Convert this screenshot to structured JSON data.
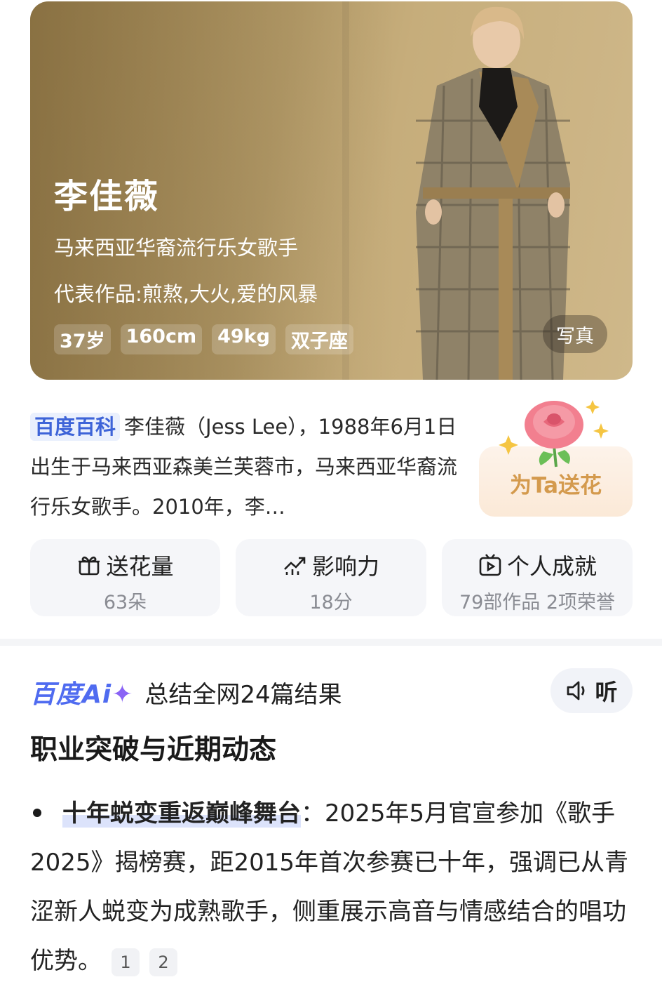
{
  "hero": {
    "name": "李佳薇",
    "subtitle": "马来西亚华裔流行乐女歌手",
    "works": "代表作品:煎熬,大火,爱的风暴",
    "tags": [
      "37岁",
      "160cm",
      "49kg",
      "双子座"
    ],
    "photo_button": "写真"
  },
  "intro": {
    "badge": "百度百科",
    "text": "李佳薇（Jess Lee），1988年6月1日出生于马来西亚森美兰芙蓉市，马来西亚华裔流行乐女歌手。2010年，李…"
  },
  "flower": {
    "label": "为Ta送花"
  },
  "stats": [
    {
      "title": "送花量",
      "value": "63朵",
      "icon": "gift-icon"
    },
    {
      "title": "影响力",
      "value": "18分",
      "icon": "trend-up-icon"
    },
    {
      "title": "个人成就",
      "value": "79部作品 2项荣誉",
      "icon": "play-tv-icon"
    }
  ],
  "ai": {
    "logo": "百度Ai",
    "summary": "总结全网24篇结果",
    "listen_label": "听"
  },
  "section": {
    "title": "职业突破与近期动态",
    "bullet_highlight": "十年蜕变重返巅峰舞台",
    "bullet_text": "：2025年5月官宣参加《歌手2025》揭榜赛，距2015年首次参赛已十年，强调已从青涩新人蜕变为成熟歌手，侧重展示高音与情感结合的唱功优势。",
    "citations": [
      "1",
      "2"
    ]
  },
  "colors": {
    "accent_blue": "#3e64d8",
    "flower_gold": "#d49a4d",
    "ai_purple": "#8a63f5"
  }
}
